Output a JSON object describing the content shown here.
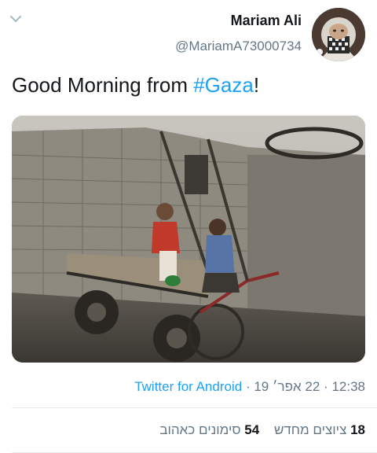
{
  "header": {
    "display_name": "Mariam Ali",
    "handle": "@MariamA73000734"
  },
  "tweet": {
    "text_prefix": "Good Morning from ",
    "hashtag": "#Gaza",
    "text_suffix": "!"
  },
  "meta": {
    "time": "12:38",
    "separator": "·",
    "date": "22 אפר׳ 19",
    "source": "Twitter for Android"
  },
  "stats": {
    "retweets_count": "18",
    "retweets_label": "ציוצים מחדש",
    "likes_count": "54",
    "likes_label": "סימונים כאהוב"
  },
  "colors": {
    "accent": "#1da1f2",
    "secondary_text": "#657786",
    "primary_text": "#14171a"
  }
}
